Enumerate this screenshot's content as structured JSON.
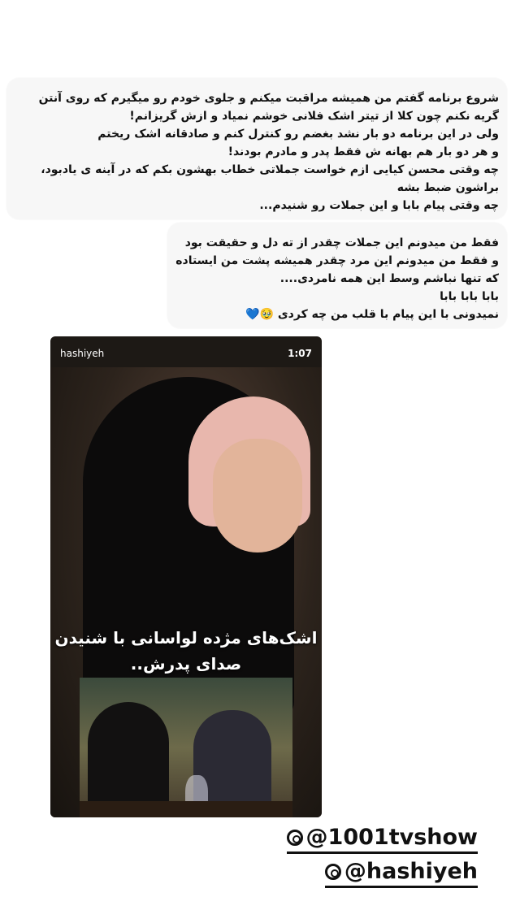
{
  "caption_block_1": {
    "lines": [
      "شروع برنامه گفتم من همیشه مراقبت میکنم و جلوی خودم رو میگیرم که روی آنتن",
      "گریه نکنم چون کلا از تیتر اشک فلانی خوشم نمیاد و ازش گریزانم!",
      "ولی در این برنامه دو بار نشد بغضم رو کنترل کنم و صادقانه اشک ریختم",
      "و هر دو بار هم بهانه ش فقط پدر و مادرم بودند!",
      "چه وقتی محسن کیایی ازم خواست جملاتی خطاب بهشون بکم که در آینه ی یادبود،",
      "براشون ضبط بشه",
      "چه وقتی پیام بابا و این جملات رو شنیدم..."
    ]
  },
  "caption_block_2": {
    "lines": [
      "فقط من میدونم این جملات چقدر از ته دل و حقیقت بود",
      "و فقط من میدونم این مرد چقدر همیشه پشت من ایستاده",
      "که تنها نباشم وسط این همه نامردی....",
      "بابا بابا بابا",
      "نمیدونی با این پیام با قلب من چه کردی 🥹💙"
    ]
  },
  "video_card": {
    "account": "hashiyeh",
    "duration": "1:07",
    "overlay_line_1": "اشک‌های مژده لواسانی با شنیدن",
    "overlay_line_2": "صدای پدرش.."
  },
  "mentions": [
    "@1001tvshow",
    "@hashiyeh"
  ]
}
